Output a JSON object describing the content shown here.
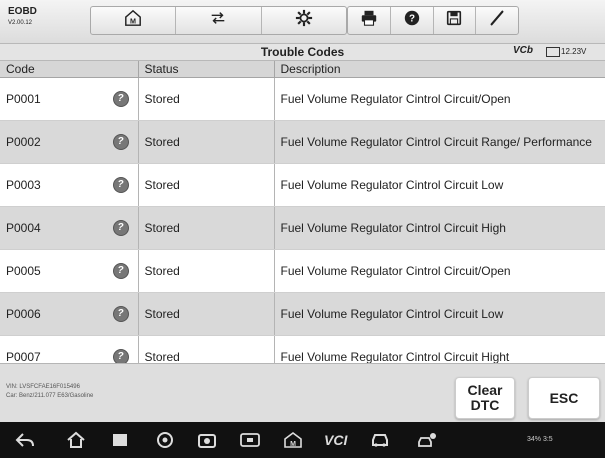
{
  "app": {
    "name": "EOBD",
    "version": "V2.00.12"
  },
  "toolbar": {
    "buttons": [
      {
        "icon": "home-m-icon"
      },
      {
        "icon": "vehicle-swap-icon"
      },
      {
        "icon": "gear-icon"
      },
      {
        "icon": "printer-icon"
      },
      {
        "icon": "help-icon"
      },
      {
        "icon": "save-icon"
      },
      {
        "icon": "pen-icon"
      }
    ]
  },
  "header": {
    "title": "Trouble Codes",
    "vci": "VCb",
    "battery": "12.23V"
  },
  "table": {
    "columns": [
      "Code",
      "Status",
      "Description"
    ],
    "rows": [
      {
        "code": "P0001",
        "status": "Stored",
        "description": "Fuel Volume Regulator Cintrol Circuit/Open"
      },
      {
        "code": "P0002",
        "status": "Stored",
        "description": "Fuel Volume Regulator Cintrol Circuit Range/ Performance"
      },
      {
        "code": "P0003",
        "status": "Stored",
        "description": "Fuel Volume Regulator Cintrol Circuit Low"
      },
      {
        "code": "P0004",
        "status": "Stored",
        "description": "Fuel Volume Regulator Cintrol Circuit High"
      },
      {
        "code": "P0005",
        "status": "Stored",
        "description": "Fuel Volume Regulator Cintrol Circuit/Open"
      },
      {
        "code": "P0006",
        "status": "Stored",
        "description": "Fuel Volume Regulator Cintrol Circuit Low"
      },
      {
        "code": "P0007",
        "status": "Stored",
        "description": "Fuel Volume Regulator Cintrol Circuit Hight"
      }
    ],
    "help_glyph": "?"
  },
  "footer": {
    "vin": "VIN: LVSFCFAE16F015496",
    "car": "Car: Benz/211.077 E63/Gasoline",
    "clear_label_1": "Clear",
    "clear_label_2": "DTC",
    "esc_label": "ESC"
  },
  "navbar": {
    "vci_label": "VCI",
    "status": "34% 3:5"
  },
  "colors": {
    "row_alt": "#d9d9d9",
    "header": "#d6d6d6",
    "navbar": "#111111"
  }
}
